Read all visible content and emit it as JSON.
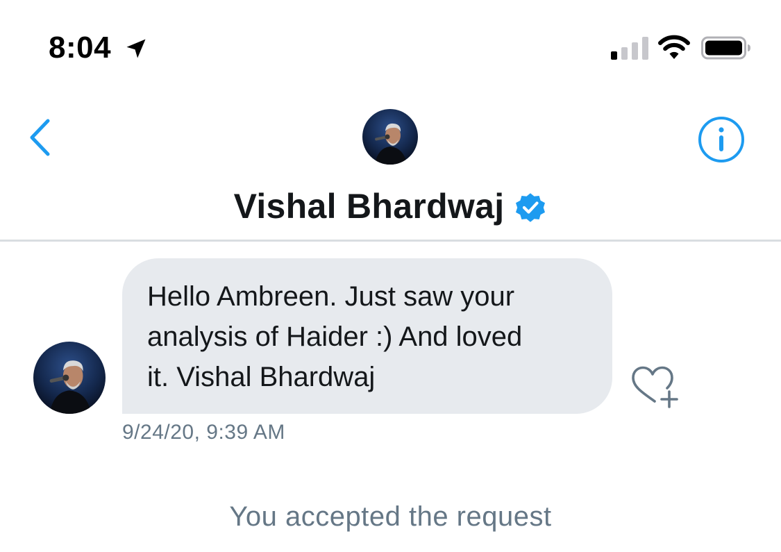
{
  "status_bar": {
    "time": "8:04",
    "icons": [
      "location-arrow-icon",
      "cellular-signal-icon",
      "wifi-icon",
      "battery-icon"
    ]
  },
  "header": {
    "back_icon": "chevron-left-icon",
    "info_icon": "info-circle-icon",
    "name": "Vishal Bhardwaj",
    "verified": true
  },
  "conversation": {
    "messages": [
      {
        "text": "Hello Ambreen. Just saw your\nanalysis of Haider :) And loved\nit. Vishal Bhardwaj",
        "timestamp": "9/24/20, 9:39 AM",
        "like_icon": "heart-plus-icon"
      }
    ],
    "system_message": "You accepted the request"
  },
  "colors": {
    "accent": "#1d9bf0",
    "bubble": "#e7eaee",
    "secondary_text": "#657786",
    "divider": "#d9dde1"
  }
}
